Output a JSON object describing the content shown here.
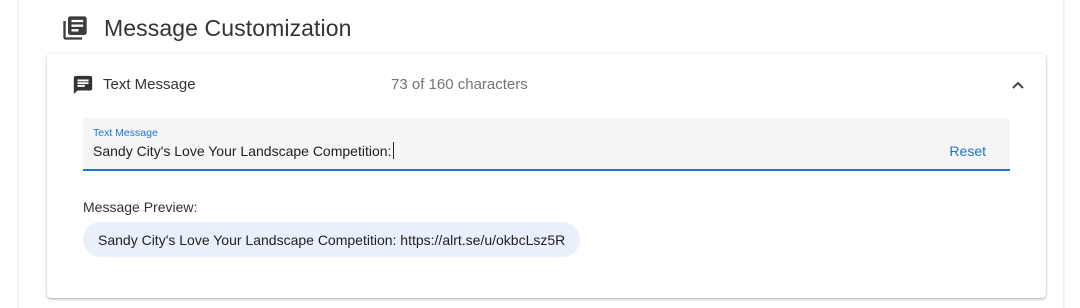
{
  "section": {
    "title": "Message Customization",
    "icon": "library-books-icon"
  },
  "panel": {
    "title": "Text Message",
    "icon": "chat-message-icon",
    "char_count": "73 of 160 characters",
    "expanded": true
  },
  "text_field": {
    "label": "Text Message",
    "value": "Sandy City's Love Your Landscape Competition:",
    "reset_label": "Reset",
    "accent_color": "#1976d2"
  },
  "preview": {
    "label": "Message Preview:",
    "text": "Sandy City's Love Your Landscape Competition: https://alrt.se/u/okbcLsz5R",
    "bubble_color": "#e9f0fb"
  }
}
